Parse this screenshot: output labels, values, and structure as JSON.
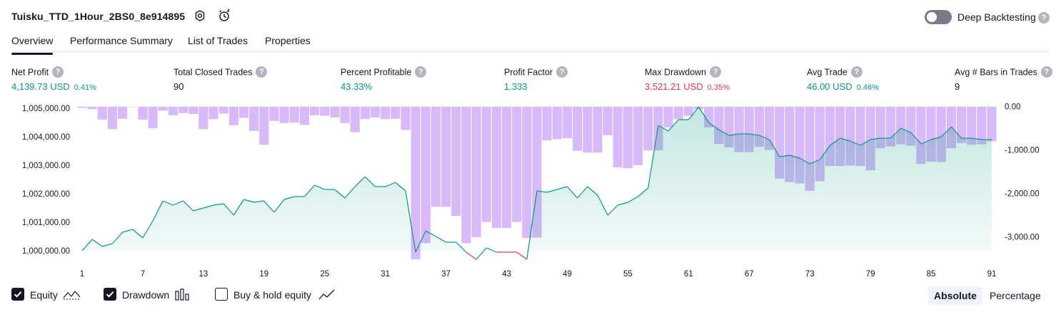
{
  "header": {
    "title": "Tuisku_TTD_1Hour_2BS0_8e914895",
    "deep_backtesting_label": "Deep Backtesting",
    "deep_backtesting_on": false,
    "help_glyph": "?"
  },
  "tabs": [
    {
      "label": "Overview",
      "active": true
    },
    {
      "label": "Performance Summary",
      "active": false
    },
    {
      "label": "List of Trades",
      "active": false
    },
    {
      "label": "Properties",
      "active": false
    }
  ],
  "metrics": [
    {
      "label": "Net Profit",
      "value": "4,139.73 USD",
      "pct": "0.41%",
      "tone": "pos"
    },
    {
      "label": "Total Closed Trades",
      "value": "90",
      "pct": "",
      "tone": "neutral"
    },
    {
      "label": "Percent Profitable",
      "value": "43.33%",
      "pct": "",
      "tone": "pos"
    },
    {
      "label": "Profit Factor",
      "value": "1.333",
      "pct": "",
      "tone": "pos"
    },
    {
      "label": "Max Drawdown",
      "value": "3,521.21 USD",
      "pct": "0.35%",
      "tone": "neg"
    },
    {
      "label": "Avg Trade",
      "value": "46.00 USD",
      "pct": "0.46%",
      "tone": "pos"
    },
    {
      "label": "Avg # Bars in Trades",
      "value": "9",
      "pct": "",
      "tone": "neutral"
    }
  ],
  "chart_data": {
    "type": "area",
    "x": [
      1,
      2,
      3,
      4,
      5,
      6,
      7,
      8,
      9,
      10,
      11,
      12,
      13,
      14,
      15,
      16,
      17,
      18,
      19,
      20,
      21,
      22,
      23,
      24,
      25,
      26,
      27,
      28,
      29,
      30,
      31,
      32,
      33,
      34,
      35,
      36,
      37,
      38,
      39,
      40,
      41,
      42,
      43,
      44,
      45,
      46,
      47,
      48,
      49,
      50,
      51,
      52,
      53,
      54,
      55,
      56,
      57,
      58,
      59,
      60,
      61,
      62,
      63,
      64,
      65,
      66,
      67,
      68,
      69,
      70,
      71,
      72,
      73,
      74,
      75,
      76,
      77,
      78,
      79,
      80,
      81,
      82,
      83,
      84,
      85,
      86,
      87,
      88,
      89,
      90,
      91
    ],
    "x_ticks": [
      "1",
      "7",
      "13",
      "19",
      "25",
      "31",
      "37",
      "43",
      "49",
      "55",
      "61",
      "67",
      "73",
      "79",
      "85",
      "91"
    ],
    "left_axis": {
      "ticks": [
        "1,000,000.00",
        "1,001,000.00",
        "1,002,000.00",
        "1,003,000.00",
        "1,004,000.00",
        "1,005,000.00"
      ],
      "range": [
        999700,
        1005150
      ]
    },
    "right_axis": {
      "ticks": [
        "0.00",
        "-1,000.00",
        "-2,000.00",
        "-3,000.00"
      ],
      "range": [
        -3520,
        60
      ]
    },
    "series": [
      {
        "name": "Equity",
        "color": "#089981",
        "values": [
          1000000,
          1000400,
          1000150,
          1000250,
          1000650,
          1000750,
          1000450,
          1001050,
          1001750,
          1001600,
          1001750,
          1001400,
          1001500,
          1001600,
          1001650,
          1001250,
          1001800,
          1001700,
          1001750,
          1001350,
          1001800,
          1001900,
          1001900,
          1002300,
          1002150,
          1002150,
          1001850,
          1002250,
          1002600,
          1002250,
          1002250,
          1002400,
          1002100,
          999950,
          1000700,
          1000500,
          1000300,
          1000300,
          999950,
          999700,
          1000100,
          999950,
          999950,
          999950,
          999700,
          1002100,
          1002050,
          1002150,
          1002250,
          1001850,
          1002250,
          1001950,
          1001250,
          1001600,
          1001700,
          1001900,
          1002200,
          1004400,
          1004200,
          1004600,
          1004600,
          1005050,
          1004500,
          1004250,
          1004050,
          1004100,
          1004100,
          1004050,
          1003900,
          1003300,
          1003350,
          1003250,
          1003050,
          1003200,
          1003700,
          1003950,
          1003850,
          1003700,
          1003900,
          1003950,
          1003950,
          1004300,
          1004150,
          1003750,
          1003900,
          1004000,
          1004350,
          1003950,
          1003950,
          1003900,
          1003900
        ],
        "below_baseline_color": "#f23645"
      },
      {
        "name": "Drawdown",
        "color": "#c69af7",
        "values": [
          -30,
          -60,
          -300,
          -520,
          -280,
          -10,
          -300,
          -500,
          -90,
          -200,
          -150,
          -170,
          -520,
          -290,
          -160,
          -430,
          -260,
          -560,
          -880,
          -330,
          -380,
          -370,
          -420,
          -200,
          -210,
          -250,
          -380,
          -590,
          -290,
          -250,
          -290,
          -280,
          -540,
          -3520,
          -3150,
          -2310,
          -2310,
          -2520,
          -3150,
          -3010,
          -2660,
          -2800,
          -2800,
          -2660,
          -3030,
          -3020,
          -780,
          -750,
          -730,
          -1020,
          -1060,
          -1060,
          -660,
          -1400,
          -1420,
          -1350,
          -1010,
          -1010,
          -480,
          -290,
          -210,
          -60,
          -480,
          -860,
          -940,
          -1050,
          -1050,
          -930,
          -1000,
          -1660,
          -1740,
          -1770,
          -1940,
          -1720,
          -1370,
          -1370,
          -1360,
          -1370,
          -1470,
          -960,
          -920,
          -870,
          -900,
          -1320,
          -1270,
          -1280,
          -960,
          -840,
          -880,
          -870,
          -800
        ]
      }
    ]
  },
  "legend": {
    "items": [
      {
        "label": "Equity",
        "checked": true
      },
      {
        "label": "Drawdown",
        "checked": true
      },
      {
        "label": "Buy & hold equity",
        "checked": false
      }
    ],
    "modes": [
      {
        "label": "Absolute",
        "active": true
      },
      {
        "label": "Percentage",
        "active": false
      }
    ]
  }
}
